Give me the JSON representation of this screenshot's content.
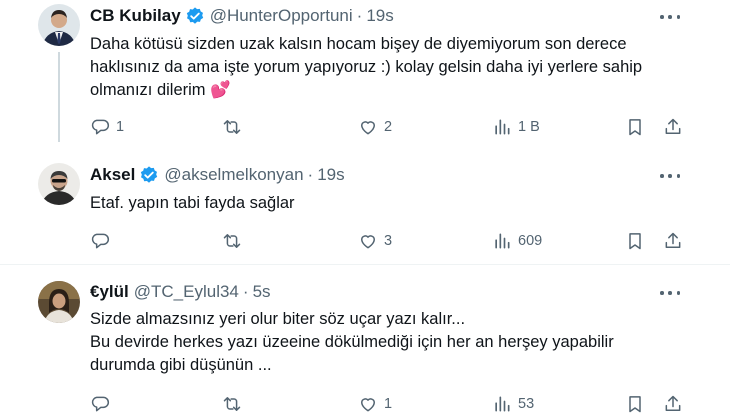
{
  "colors": {
    "text": "#0f1419",
    "muted": "#536471",
    "verified": "#1d9bf0",
    "divider": "#eff3f4"
  },
  "tweets": [
    {
      "display_name": "CB Kubilay",
      "handle": "@HunterOpportuni",
      "separator": "·",
      "time": "19s",
      "verified": true,
      "lines": [
        "Daha kötüsü sizden uzak kalsın hocam bişey de diyemiyorum son derece",
        "haklısınız da ama işte yorum yapıyoruz :) kolay gelsin daha iyi yerlere sahip",
        "olmanızı dilerim 💕"
      ],
      "replies": "1",
      "retweets": "",
      "likes": "2",
      "views": "1 B"
    },
    {
      "display_name": "Aksel",
      "handle": "@akselmelkonyan",
      "separator": "·",
      "time": "19s",
      "verified": true,
      "lines": [
        "Etaf. yapın tabi fayda sağlar"
      ],
      "replies": "",
      "retweets": "",
      "likes": "3",
      "views": "609"
    },
    {
      "display_name": "€ylül",
      "handle": "@TC_Eylul34",
      "separator": "·",
      "time": "5s",
      "verified": false,
      "lines": [
        "Sizde almazsınız yeri olur biter söz uçar yazı kalır...",
        "Bu devirde herkes yazı üzeeine dökülmediği için her an herşey yapabilir",
        "durumda gibi düşünün ..."
      ],
      "replies": "",
      "retweets": "",
      "likes": "1",
      "views": "53"
    }
  ],
  "icons": [
    "reply-icon",
    "retweet-icon",
    "like-icon",
    "views-icon",
    "bookmark-icon",
    "share-icon",
    "verified-icon",
    "more-icon"
  ]
}
